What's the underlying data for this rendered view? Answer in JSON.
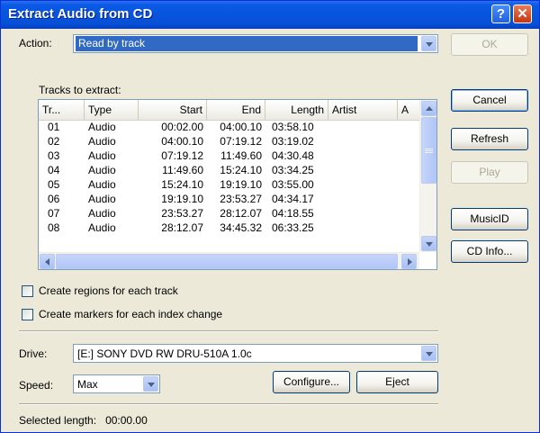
{
  "window": {
    "title": "Extract Audio from CD"
  },
  "titlebar": {
    "help_glyph": "?",
    "close_glyph": "✕"
  },
  "action": {
    "label": "Action:",
    "value": "Read by track"
  },
  "tracks": {
    "label": "Tracks to extract:",
    "columns": [
      "Tr...",
      "Type",
      "Start",
      "End",
      "Length",
      "Artist",
      "A"
    ],
    "rows": [
      [
        "01",
        "Audio",
        "00:02.00",
        "04:00.10",
        "03:58.10"
      ],
      [
        "02",
        "Audio",
        "04:00.10",
        "07:19.12",
        "03:19.02"
      ],
      [
        "03",
        "Audio",
        "07:19.12",
        "11:49.60",
        "04:30.48"
      ],
      [
        "04",
        "Audio",
        "11:49.60",
        "15:24.10",
        "03:34.25"
      ],
      [
        "05",
        "Audio",
        "15:24.10",
        "19:19.10",
        "03:55.00"
      ],
      [
        "06",
        "Audio",
        "19:19.10",
        "23:53.27",
        "04:34.17"
      ],
      [
        "07",
        "Audio",
        "23:53.27",
        "28:12.07",
        "04:18.55"
      ],
      [
        "08",
        "Audio",
        "28:12.07",
        "34:45.32",
        "06:33.25"
      ]
    ]
  },
  "buttons": {
    "ok": "OK",
    "cancel": "Cancel",
    "refresh": "Refresh",
    "play": "Play",
    "musicid": "MusicID",
    "cdinfo": "CD Info...",
    "configure": "Configure...",
    "eject": "Eject"
  },
  "options": {
    "create_regions": "Create regions for each track",
    "create_markers": "Create markers for each index change"
  },
  "drive": {
    "label": "Drive:",
    "value": "[E:] SONY DVD RW DRU-510A 1.0c"
  },
  "speed": {
    "label": "Speed:",
    "value": "Max"
  },
  "status": {
    "selected_length": "Selected length:   00:00.00"
  },
  "colors": {
    "titlebar": "#0855dd",
    "dialog": "#ece9d8",
    "selection": "#316ac5"
  }
}
